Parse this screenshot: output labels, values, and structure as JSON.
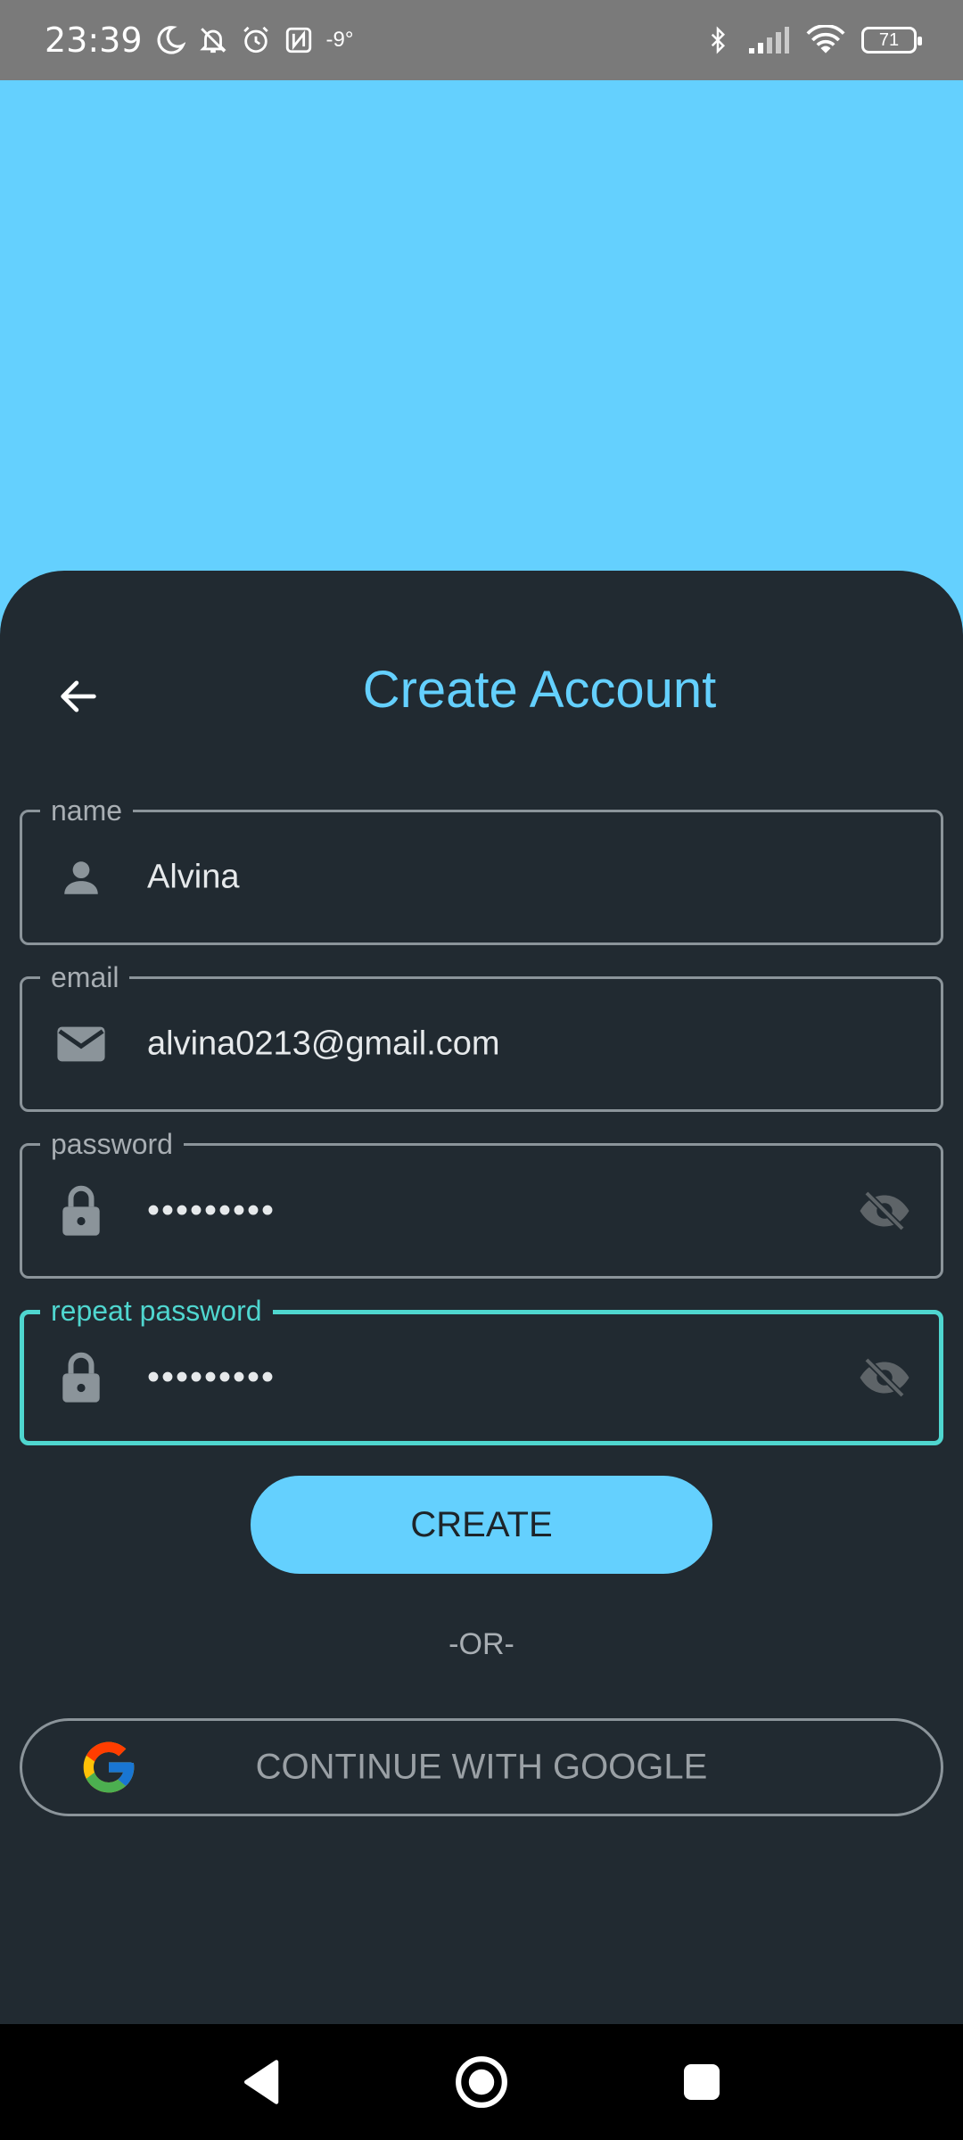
{
  "status_bar": {
    "time": "23:39",
    "temperature": "-9°",
    "battery": "71"
  },
  "screen": {
    "title": "Create Account",
    "accent_color": "#64d0fe",
    "focus_color": "#4fd6cf",
    "background_color": "#212a31"
  },
  "form": {
    "name": {
      "label": "name",
      "value": "Alvina",
      "icon": "person-icon"
    },
    "email": {
      "label": "email",
      "value": "alvina0213@gmail.com",
      "icon": "mail-icon"
    },
    "password": {
      "label": "password",
      "value": "•••••••••",
      "icon": "lock-icon",
      "toggle_icon": "eye-off-icon"
    },
    "repeat_password": {
      "label": "repeat password",
      "value": "•••••••••",
      "icon": "lock-icon",
      "toggle_icon": "eye-off-icon",
      "focused": true
    }
  },
  "actions": {
    "create_label": "CREATE",
    "or_text": "-OR-",
    "google_label": "CONTINUE WITH GOOGLE"
  }
}
